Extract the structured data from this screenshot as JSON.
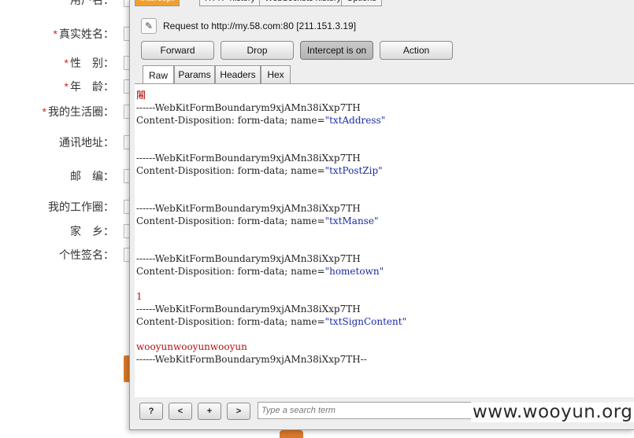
{
  "background_form": {
    "rows": [
      {
        "label": "用户名：",
        "required": false
      },
      {
        "label": "真实姓名：",
        "required": true
      },
      {
        "label": "性　别：",
        "required": true
      },
      {
        "label": "年　龄：",
        "required": true
      },
      {
        "label": "我的生活圈：",
        "required": true
      },
      {
        "label": "通讯地址：",
        "required": false
      },
      {
        "label": "邮　编：",
        "required": false
      },
      {
        "label": "我的工作圈：",
        "required": false
      },
      {
        "label": "家　乡：",
        "required": false
      },
      {
        "label": "个性签名：",
        "required": false
      }
    ],
    "required_mark": "*"
  },
  "burp": {
    "top_tabs": [
      "Intercept",
      "HTTP history",
      "WebSockets history",
      "Options"
    ],
    "request_line": "Request to http://my.58.com:80  [211.151.3.19]",
    "buttons": {
      "forward": "Forward",
      "drop": "Drop",
      "intercept": "Intercept is on",
      "action": "Action"
    },
    "sub_tabs": [
      "Raw",
      "Params",
      "Headers",
      "Hex"
    ],
    "body_lines": [
      {
        "text": "闂",
        "style": "red"
      },
      {
        "text": "------WebKitFormBoundarym9xjAMn38iXxp7TH",
        "style": "plain"
      },
      {
        "prefix": "Content-Disposition: form-data; name=",
        "value": "\"txtAddress\"",
        "style": "cd"
      },
      {
        "text": "",
        "style": "plain"
      },
      {
        "text": "",
        "style": "plain"
      },
      {
        "text": "------WebKitFormBoundarym9xjAMn38iXxp7TH",
        "style": "plain"
      },
      {
        "prefix": "Content-Disposition: form-data; name=",
        "value": "\"txtPostZip\"",
        "style": "cd"
      },
      {
        "text": "",
        "style": "plain"
      },
      {
        "text": "",
        "style": "plain"
      },
      {
        "text": "------WebKitFormBoundarym9xjAMn38iXxp7TH",
        "style": "plain"
      },
      {
        "prefix": "Content-Disposition: form-data; name=",
        "value": "\"txtManse\"",
        "style": "cd"
      },
      {
        "text": "",
        "style": "plain"
      },
      {
        "text": "",
        "style": "plain"
      },
      {
        "text": "------WebKitFormBoundarym9xjAMn38iXxp7TH",
        "style": "plain"
      },
      {
        "prefix": "Content-Disposition: form-data; name=",
        "value": "\"hometown\"",
        "style": "cd"
      },
      {
        "text": "",
        "style": "plain"
      },
      {
        "text": "1",
        "style": "red"
      },
      {
        "text": "------WebKitFormBoundarym9xjAMn38iXxp7TH",
        "style": "plain"
      },
      {
        "prefix": "Content-Disposition: form-data; name=",
        "value": "\"txtSignContent\"",
        "style": "cd"
      },
      {
        "text": "",
        "style": "plain"
      },
      {
        "text": "wooyunwooyunwooyun",
        "style": "red"
      },
      {
        "text": "------WebKitFormBoundarym9xjAMn38iXxp7TH--",
        "style": "plain"
      }
    ],
    "bottom": {
      "help": "?",
      "prev": "<",
      "add": "+",
      "next": ">",
      "search_placeholder": "Type a search term"
    }
  },
  "watermark": "www.wooyun.org",
  "colors": {
    "accent_tab": "#f0a030",
    "boundary_value": "#1a2aa8",
    "payload": "#b01010",
    "required": "#e02020"
  }
}
